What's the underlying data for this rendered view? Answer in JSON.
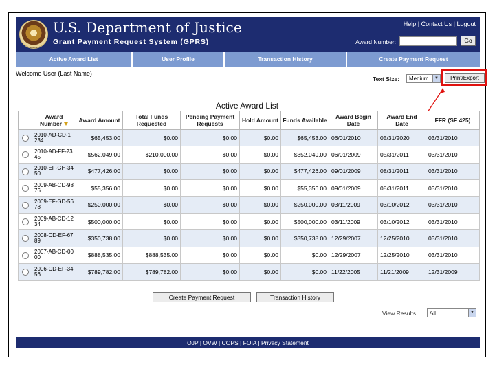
{
  "header": {
    "dept_title": "U.S. Department of Justice",
    "system_title": "Grant Payment Request System (GPRS)",
    "links": [
      "Help",
      "Contact Us",
      "Logout"
    ],
    "award_number_label": "Award Number:",
    "award_number_value": "",
    "go_label": "Go"
  },
  "nav": {
    "tabs": [
      {
        "label": "Active Award List"
      },
      {
        "label": "User Profile"
      },
      {
        "label": "Transaction History"
      },
      {
        "label": "Create Payment Request"
      }
    ]
  },
  "welcome": "Welcome User (Last Name)",
  "text_size": {
    "label": "Text Size:",
    "value": "Medium"
  },
  "print_export_label": "Print/Export",
  "table": {
    "title": "Active Award List",
    "headers": [
      "Award Number",
      "Award Amount",
      "Total Funds Requested",
      "Pending Payment Requests",
      "Hold Amount",
      "Funds Available",
      "Award Begin Date",
      "Award End Date",
      "FFR (SF 425)"
    ],
    "rows": [
      [
        "2010-AD-CD-1234",
        "$65,453.00",
        "$0.00",
        "$0.00",
        "$0.00",
        "$65,453.00",
        "06/01/2010",
        "05/31/2020",
        "03/31/2010"
      ],
      [
        "2010-AD-FF-2345",
        "$562,049.00",
        "$210,000.00",
        "$0.00",
        "$0.00",
        "$352,049.00",
        "06/01/2009",
        "05/31/2011",
        "03/31/2010"
      ],
      [
        "2010-EF-GH-3450",
        "$477,426.00",
        "$0.00",
        "$0.00",
        "$0.00",
        "$477,426.00",
        "09/01/2009",
        "08/31/2011",
        "03/31/2010"
      ],
      [
        "2009-AB-CD-9876",
        "$55,356.00",
        "$0.00",
        "$0.00",
        "$0.00",
        "$55,356.00",
        "09/01/2009",
        "08/31/2011",
        "03/31/2010"
      ],
      [
        "2009-EF-GD-5678",
        "$250,000.00",
        "$0.00",
        "$0.00",
        "$0.00",
        "$250,000.00",
        "03/11/2009",
        "03/10/2012",
        "03/31/2010"
      ],
      [
        "2009-AB-CD-1234",
        "$500,000.00",
        "$0.00",
        "$0.00",
        "$0.00",
        "$500,000.00",
        "03/11/2009",
        "03/10/2012",
        "03/31/2010"
      ],
      [
        "2008-CD-EF-6789",
        "$350,738.00",
        "$0.00",
        "$0.00",
        "$0.00",
        "$350,738.00",
        "12/29/2007",
        "12/25/2010",
        "03/31/2010"
      ],
      [
        "2007-AB-CD-0000",
        "$888,535.00",
        "$888,535.00",
        "$0.00",
        "$0.00",
        "$0.00",
        "12/29/2007",
        "12/25/2010",
        "03/31/2010"
      ],
      [
        "2006-CD-EF-3456",
        "$789,782.00",
        "$789,782.00",
        "$0.00",
        "$0.00",
        "$0.00",
        "11/22/2005",
        "11/21/2009",
        "12/31/2009"
      ]
    ]
  },
  "buttons": {
    "create_payment": "Create Payment Request",
    "transaction_history": "Transaction History"
  },
  "view_results": {
    "label": "View Results",
    "value": "All"
  },
  "footer": "OJP | OVW | COPS | FOIA | Privacy Statement",
  "colors": {
    "header_bg": "#1d2c70",
    "nav_bg": "#7d9bd1",
    "row_alt": "#e5ecf6",
    "highlight": "#e0120f"
  }
}
